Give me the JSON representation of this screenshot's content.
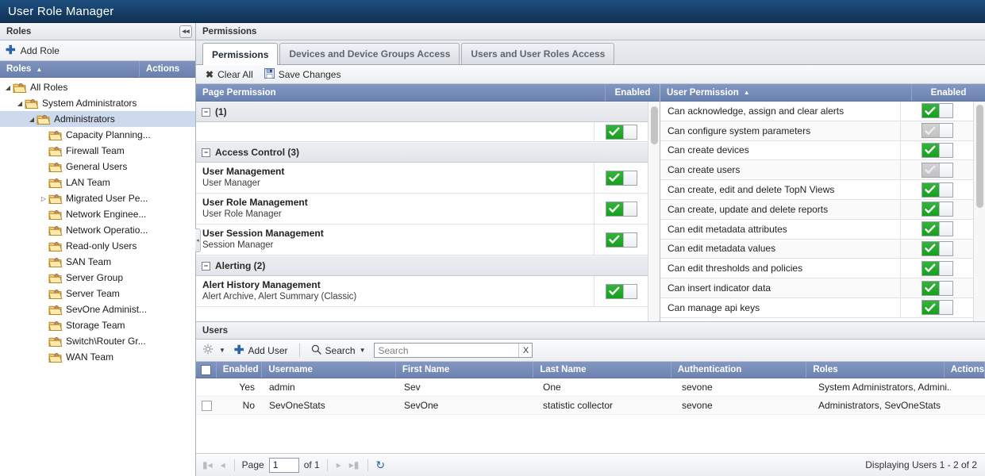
{
  "app": {
    "title": "User Role Manager"
  },
  "roles_panel": {
    "header": "Roles",
    "collapse_icon": "collapse-left-icon",
    "add_role": "Add Role",
    "grid": {
      "col_roles": "Roles",
      "col_actions": "Actions",
      "sort_arrow": "▲"
    },
    "tree": [
      {
        "label": "All Roles",
        "depth": 0,
        "twisty": "◢",
        "selected": false
      },
      {
        "label": "System Administrators",
        "depth": 1,
        "twisty": "◢",
        "selected": false
      },
      {
        "label": "Administrators",
        "depth": 2,
        "twisty": "◢",
        "selected": true
      },
      {
        "label": "Capacity Planning...",
        "depth": 3,
        "twisty": "",
        "selected": false
      },
      {
        "label": "Firewall Team",
        "depth": 3,
        "twisty": "",
        "selected": false
      },
      {
        "label": "General Users",
        "depth": 3,
        "twisty": "",
        "selected": false
      },
      {
        "label": "LAN Team",
        "depth": 3,
        "twisty": "",
        "selected": false
      },
      {
        "label": "Migrated User Pe...",
        "depth": 3,
        "twisty": "▷",
        "selected": false
      },
      {
        "label": "Network Enginee...",
        "depth": 3,
        "twisty": "",
        "selected": false
      },
      {
        "label": "Network Operatio...",
        "depth": 3,
        "twisty": "",
        "selected": false
      },
      {
        "label": "Read-only Users",
        "depth": 3,
        "twisty": "",
        "selected": false
      },
      {
        "label": "SAN Team",
        "depth": 3,
        "twisty": "",
        "selected": false
      },
      {
        "label": "Server Group",
        "depth": 3,
        "twisty": "",
        "selected": false
      },
      {
        "label": "Server Team",
        "depth": 3,
        "twisty": "",
        "selected": false
      },
      {
        "label": "SevOne Administ...",
        "depth": 3,
        "twisty": "",
        "selected": false
      },
      {
        "label": "Storage Team",
        "depth": 3,
        "twisty": "",
        "selected": false
      },
      {
        "label": "Switch\\Router Gr...",
        "depth": 3,
        "twisty": "",
        "selected": false
      },
      {
        "label": "WAN Team",
        "depth": 3,
        "twisty": "",
        "selected": false
      }
    ]
  },
  "permissions_panel": {
    "header": "Permissions",
    "tabs": [
      {
        "label": "Permissions",
        "active": true
      },
      {
        "label": "Devices and Device Groups Access",
        "active": false
      },
      {
        "label": "Users and User Roles Access",
        "active": false
      }
    ],
    "actions": {
      "clear_all": "Clear All",
      "save_changes": "Save Changes"
    },
    "page_grid": {
      "col_permission": "Page Permission",
      "col_enabled": "Enabled",
      "sort_arrow": "",
      "groups": [
        {
          "title": "(1)",
          "rows": [
            {
              "name": "",
              "desc": "",
              "enabled": true,
              "blank": true
            }
          ]
        },
        {
          "title": "Access Control (3)",
          "rows": [
            {
              "name": "User Management",
              "desc": "User Manager",
              "enabled": true,
              "blank": false
            },
            {
              "name": "User Role Management",
              "desc": "User Role Manager",
              "enabled": true,
              "blank": false
            },
            {
              "name": "User Session Management",
              "desc": "Session Manager",
              "enabled": true,
              "blank": false
            }
          ]
        },
        {
          "title": "Alerting (2)",
          "rows": [
            {
              "name": "Alert History Management",
              "desc": "Alert Archive, Alert Summary (Classic)",
              "enabled": true,
              "blank": false
            }
          ]
        }
      ]
    },
    "user_grid": {
      "col_permission": "User Permission",
      "col_enabled": "Enabled",
      "sort_arrow": "▲",
      "rows": [
        {
          "name": "Can acknowledge, assign and clear alerts",
          "enabled": true
        },
        {
          "name": "Can configure system parameters",
          "enabled": false
        },
        {
          "name": "Can create devices",
          "enabled": true
        },
        {
          "name": "Can create users",
          "enabled": false
        },
        {
          "name": "Can create, edit and delete TopN Views",
          "enabled": true
        },
        {
          "name": "Can create, update and delete reports",
          "enabled": true
        },
        {
          "name": "Can edit metadata attributes",
          "enabled": true
        },
        {
          "name": "Can edit metadata values",
          "enabled": true
        },
        {
          "name": "Can edit thresholds and policies",
          "enabled": true
        },
        {
          "name": "Can insert indicator data",
          "enabled": true
        },
        {
          "name": "Can manage api keys",
          "enabled": true
        }
      ]
    }
  },
  "users_panel": {
    "header": "Users",
    "toolbar": {
      "settings_icon": "gear-icon",
      "add_user": "Add User",
      "search_label": "Search",
      "search_value": "",
      "search_placeholder": "Search",
      "clear_label": "X"
    },
    "columns": [
      "Enabled",
      "Username",
      "First Name",
      "Last Name",
      "Authentication",
      "Roles",
      "Actions"
    ],
    "rows": [
      {
        "checkbox": false,
        "show_checkbox": false,
        "enabled": "Yes",
        "username": "admin",
        "first_name": "Sev",
        "last_name": "One",
        "authentication": "sevone",
        "roles": "System Administrators, Admini...",
        "actions": ""
      },
      {
        "checkbox": false,
        "show_checkbox": true,
        "enabled": "No",
        "username": "SevOneStats",
        "first_name": "SevOne",
        "last_name": "statistic collector",
        "authentication": "sevone",
        "roles": "Administrators, SevOneStats",
        "actions": ""
      }
    ],
    "pager": {
      "first_icon": "first-page-icon",
      "prev_icon": "previous-page-icon",
      "page_label": "Page",
      "page_value": "1",
      "of_label": "of 1",
      "next_icon": "next-page-icon",
      "last_icon": "last-page-icon",
      "refresh_icon": "refresh-icon",
      "status": "Displaying Users 1 - 2 of 2"
    }
  },
  "colors": {
    "title_bar": "#17406a",
    "grid_header": "#7489b5",
    "selection": "#cdd9ec",
    "toggle_on": "#1ea428",
    "toggle_off": "#c8c8c8",
    "accent_link": "#2b62a8"
  }
}
